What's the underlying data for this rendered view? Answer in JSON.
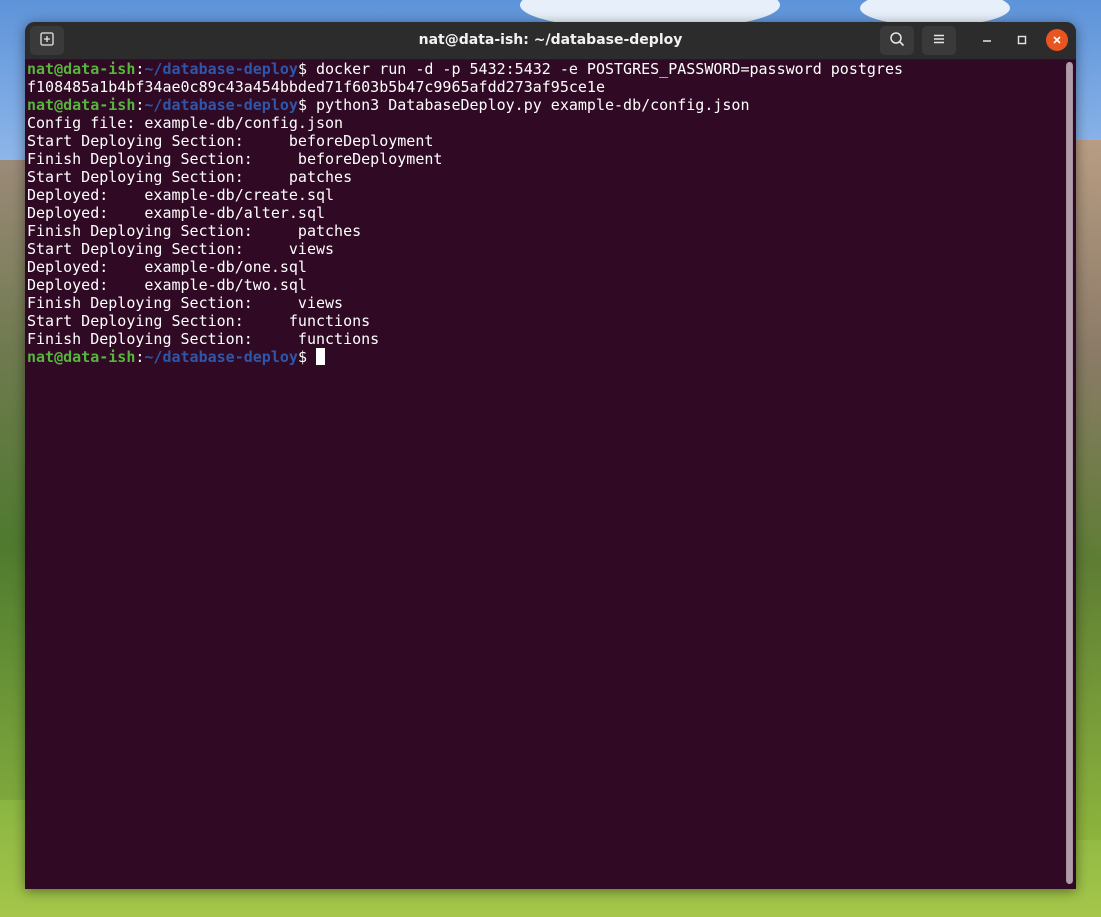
{
  "window": {
    "title": "nat@data-ish: ~/database-deploy",
    "icons": {
      "new_tab": "new-tab-icon",
      "search": "search-icon",
      "menu": "hamburger-menu-icon",
      "minimize": "minimize-icon",
      "maximize": "maximize-icon",
      "close": "close-icon"
    },
    "colors": {
      "terminal_bg": "#300a24",
      "prompt_user": "#56b63c",
      "prompt_path": "#2f56a8",
      "close_button": "#e95420"
    }
  },
  "terminal": {
    "prompt": {
      "user_host": "nat@data-ish",
      "separator": ":",
      "path": "~/database-deploy",
      "symbol": "$"
    },
    "lines": [
      {
        "type": "prompt",
        "command": " docker run -d -p 5432:5432 -e POSTGRES_PASSWORD=password postgres"
      },
      {
        "type": "output",
        "text": "f108485a1b4bf34ae0c89c43a454bbded71f603b5b47c9965afdd273af95ce1e"
      },
      {
        "type": "prompt",
        "command": " python3 DatabaseDeploy.py example-db/config.json"
      },
      {
        "type": "output",
        "text": "Config file: example-db/config.json"
      },
      {
        "type": "output",
        "text": "Start Deploying Section:     beforeDeployment"
      },
      {
        "type": "output",
        "text": "Finish Deploying Section:     beforeDeployment"
      },
      {
        "type": "output",
        "text": "Start Deploying Section:     patches"
      },
      {
        "type": "output",
        "text": "Deployed:    example-db/create.sql"
      },
      {
        "type": "output",
        "text": "Deployed:    example-db/alter.sql"
      },
      {
        "type": "output",
        "text": "Finish Deploying Section:     patches"
      },
      {
        "type": "output",
        "text": "Start Deploying Section:     views"
      },
      {
        "type": "output",
        "text": "Deployed:    example-db/one.sql"
      },
      {
        "type": "output",
        "text": "Deployed:    example-db/two.sql"
      },
      {
        "type": "output",
        "text": "Finish Deploying Section:     views"
      },
      {
        "type": "output",
        "text": "Start Deploying Section:     functions"
      },
      {
        "type": "output",
        "text": "Finish Deploying Section:     functions"
      },
      {
        "type": "prompt",
        "command": " ",
        "cursor": true
      }
    ]
  }
}
